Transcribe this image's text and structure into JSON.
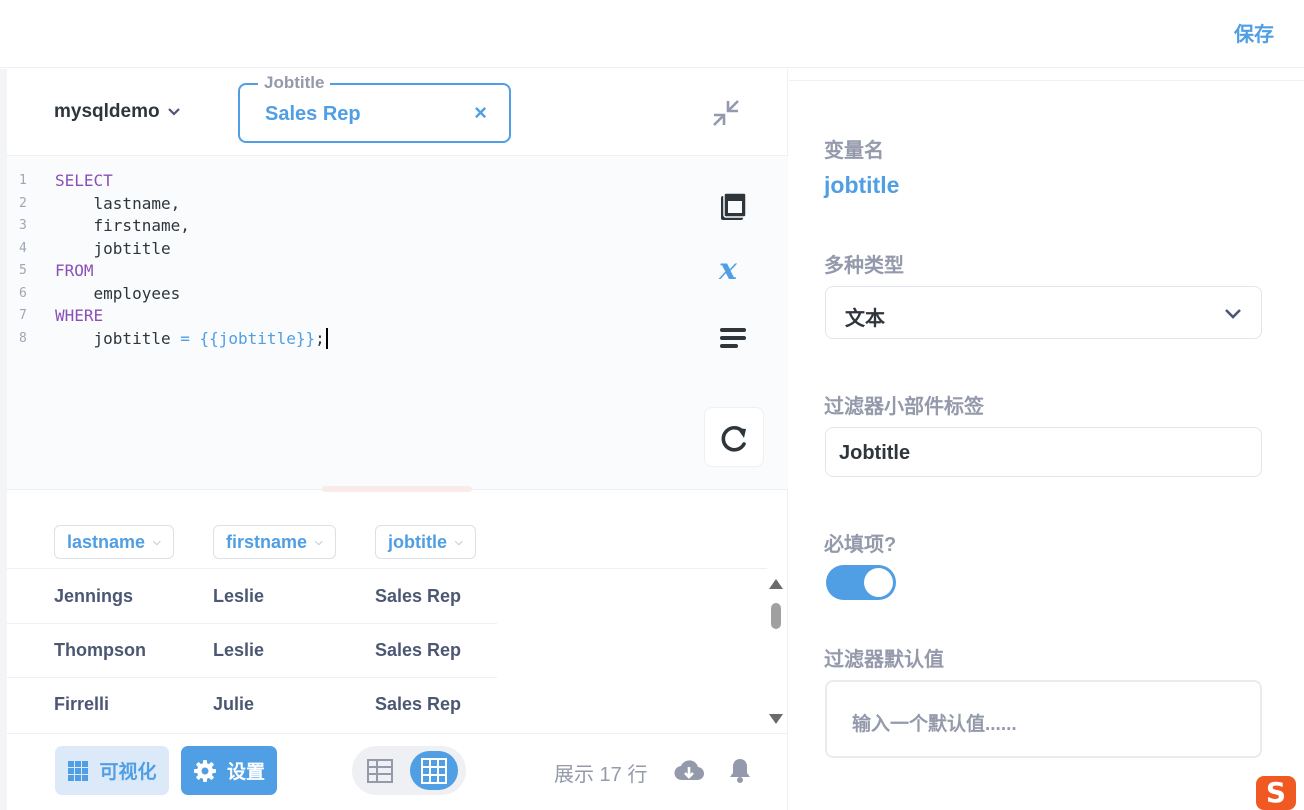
{
  "header": {
    "save_label": "保存"
  },
  "editor": {
    "database": "mysqldemo",
    "tag_widget": {
      "label": "Jobtitle",
      "value": "Sales Rep",
      "clear": "×"
    },
    "code_lines": [
      {
        "n": "1",
        "parts": [
          {
            "t": "SELECT",
            "c": "kw"
          }
        ]
      },
      {
        "n": "2",
        "parts": [
          {
            "t": "    lastname,",
            "c": "txt"
          }
        ]
      },
      {
        "n": "3",
        "parts": [
          {
            "t": "    firstname,",
            "c": "txt"
          }
        ]
      },
      {
        "n": "4",
        "parts": [
          {
            "t": "    jobtitle",
            "c": "txt"
          }
        ]
      },
      {
        "n": "5",
        "parts": [
          {
            "t": "FROM",
            "c": "kw"
          }
        ]
      },
      {
        "n": "6",
        "parts": [
          {
            "t": "    employees",
            "c": "txt"
          }
        ]
      },
      {
        "n": "7",
        "parts": [
          {
            "t": "WHERE",
            "c": "kw"
          }
        ]
      },
      {
        "n": "8",
        "parts": [
          {
            "t": "    jobtitle ",
            "c": "txt"
          },
          {
            "t": "= {{jobtitle}}",
            "c": "var"
          },
          {
            "t": ";",
            "c": "txt"
          }
        ]
      }
    ]
  },
  "results": {
    "columns": [
      "lastname",
      "firstname",
      "jobtitle"
    ],
    "rows": [
      [
        "Jennings",
        "Leslie",
        "Sales Rep"
      ],
      [
        "Thompson",
        "Leslie",
        "Sales Rep"
      ],
      [
        "Firrelli",
        "Julie",
        "Sales Rep"
      ]
    ]
  },
  "footer": {
    "visualize_label": "可视化",
    "settings_label": "设置",
    "row_count": "展示 17 行"
  },
  "sidebar": {
    "var_name_label": "变量名",
    "var_name": "jobtitle",
    "type_label": "多种类型",
    "type_value": "文本",
    "widget_label_label": "过滤器小部件标签",
    "widget_label_value": "Jobtitle",
    "required_label": "必填项?",
    "required": true,
    "default_label": "过滤器默认值",
    "default_placeholder": "输入一个默认值......"
  },
  "ime": {
    "glyph": "S"
  },
  "colors": {
    "brand": "#509ee3",
    "keyword": "#8b50b8",
    "text": "#4c5773",
    "muted": "#949aab"
  }
}
